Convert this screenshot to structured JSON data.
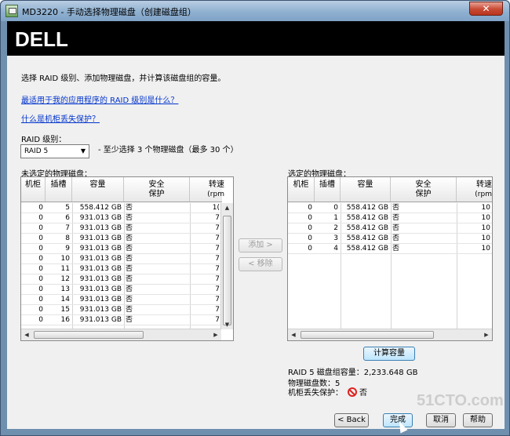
{
  "window": {
    "title": "MD3220 - 手动选择物理磁盘（创建磁盘组）",
    "close_glyph": "✕"
  },
  "banner": {
    "logo": "DELL"
  },
  "instructions": "选择 RAID 级别、添加物理磁盘，并计算该磁盘组的容量。",
  "links": [
    "最适用于我的应用程序的 RAID 级别是什么？",
    "什么是机柜丢失保护？"
  ],
  "raid": {
    "label": "RAID 级别：",
    "selected": "RAID 5",
    "hint": "- 至少选择 3 个物理磁盘（最多 30 个）"
  },
  "unselected": {
    "label": "未选定的物理磁盘：",
    "columns": [
      "机柜",
      "插槽",
      "容量",
      "安全",
      "保护",
      "转速",
      "(rpm"
    ],
    "rows": [
      [
        "0",
        "5",
        "558.412 GB",
        "否",
        "1("
      ],
      [
        "0",
        "6",
        "931.013 GB",
        "否",
        "7"
      ],
      [
        "0",
        "7",
        "931.013 GB",
        "否",
        "7"
      ],
      [
        "0",
        "8",
        "931.013 GB",
        "否",
        "7"
      ],
      [
        "0",
        "9",
        "931.013 GB",
        "否",
        "7"
      ],
      [
        "0",
        "10",
        "931.013 GB",
        "否",
        "7"
      ],
      [
        "0",
        "11",
        "931.013 GB",
        "否",
        "7"
      ],
      [
        "0",
        "12",
        "931.013 GB",
        "否",
        "7"
      ],
      [
        "0",
        "13",
        "931.013 GB",
        "否",
        "7"
      ],
      [
        "0",
        "14",
        "931.013 GB",
        "否",
        "7"
      ],
      [
        "0",
        "15",
        "931.013 GB",
        "否",
        "7"
      ],
      [
        "0",
        "16",
        "931.013 GB",
        "否",
        "7"
      ]
    ]
  },
  "selected": {
    "label": "选定的物理磁盘：",
    "columns": [
      "机柜",
      "插槽",
      "容量",
      "安全",
      "保护",
      "转速",
      "(rpm"
    ],
    "rows": [
      [
        "0",
        "0",
        "558.412 GB",
        "否",
        "10"
      ],
      [
        "0",
        "1",
        "558.412 GB",
        "否",
        "10"
      ],
      [
        "0",
        "2",
        "558.412 GB",
        "否",
        "10"
      ],
      [
        "0",
        "3",
        "558.412 GB",
        "否",
        "10"
      ],
      [
        "0",
        "4",
        "558.412 GB",
        "否",
        "10"
      ]
    ]
  },
  "buttons": {
    "add": "添加 >",
    "remove": "< 移除",
    "calculate": "计算容量",
    "back": "< Back",
    "finish": "完成",
    "cancel": "取消",
    "help": "帮助"
  },
  "summary": {
    "capacity": "RAID 5 磁盘组容量：2,233.648 GB",
    "disk_count": "物理磁盘数：5",
    "loss_protection_label": "机柜丢失保护：",
    "loss_protection_value": "否"
  },
  "watermark": "51CTO.com"
}
